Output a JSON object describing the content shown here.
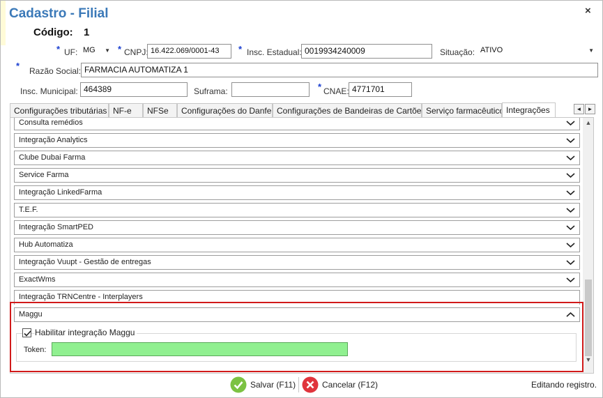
{
  "window": {
    "title": "Cadastro - Filial",
    "close_glyph": "×"
  },
  "header": {
    "codigo_label": "Código:",
    "codigo_value": "1"
  },
  "form": {
    "uf_label": "UF:",
    "uf_value": "MG",
    "cnpj_label": "CNPJ:",
    "cnpj_value": "16.422.069/0001-43",
    "ie_label": "Insc. Estadual:",
    "ie_value": "0019934240009",
    "situacao_label": "Situação:",
    "situacao_value": "ATIVO",
    "razao_label": "Razão Social:",
    "razao_value": "FARMACIA AUTOMATIZA 1",
    "im_label": "Insc. Municipal:",
    "im_value": "464389",
    "suframa_label": "Suframa:",
    "suframa_value": "",
    "cnae_label": "CNAE:",
    "cnae_value": "4771701",
    "required_mark": "*"
  },
  "tabs": [
    {
      "label": "Configurações tributárias"
    },
    {
      "label": "NF-e"
    },
    {
      "label": "NFSe"
    },
    {
      "label": "Configurações do Danfe"
    },
    {
      "label": "Configurações de Bandeiras de Cartões"
    },
    {
      "label": "Serviço farmacêutico"
    },
    {
      "label": "Integrações"
    }
  ],
  "tab_scroll": {
    "left": "◄",
    "right": "►"
  },
  "integrations": [
    {
      "label": "Consulta remédios"
    },
    {
      "label": "Integração Analytics"
    },
    {
      "label": "Clube Dubai Farma"
    },
    {
      "label": "Service Farma"
    },
    {
      "label": "Integração LinkedFarma"
    },
    {
      "label": "T.E.F."
    },
    {
      "label": "Integração SmartPED"
    },
    {
      "label": "Hub Automatiza"
    },
    {
      "label": "Integração Vuupt - Gestão de entregas"
    },
    {
      "label": "ExactWms"
    },
    {
      "label": "Integração TRNCentre - Interplayers"
    }
  ],
  "maggu": {
    "title": "Maggu",
    "enable_label": "Habilitar integração Maggu",
    "enabled": true,
    "token_label": "Token:",
    "token_value": ""
  },
  "footer": {
    "save_label": "Salvar (F11)",
    "cancel_label": "Cancelar (F12)",
    "status": "Editando registro."
  },
  "colors": {
    "title": "#3b79b8",
    "highlight_frame": "#d11a1a",
    "token_bg": "#90f090",
    "save_green": "#7cc242",
    "cancel_red": "#e0343c"
  }
}
